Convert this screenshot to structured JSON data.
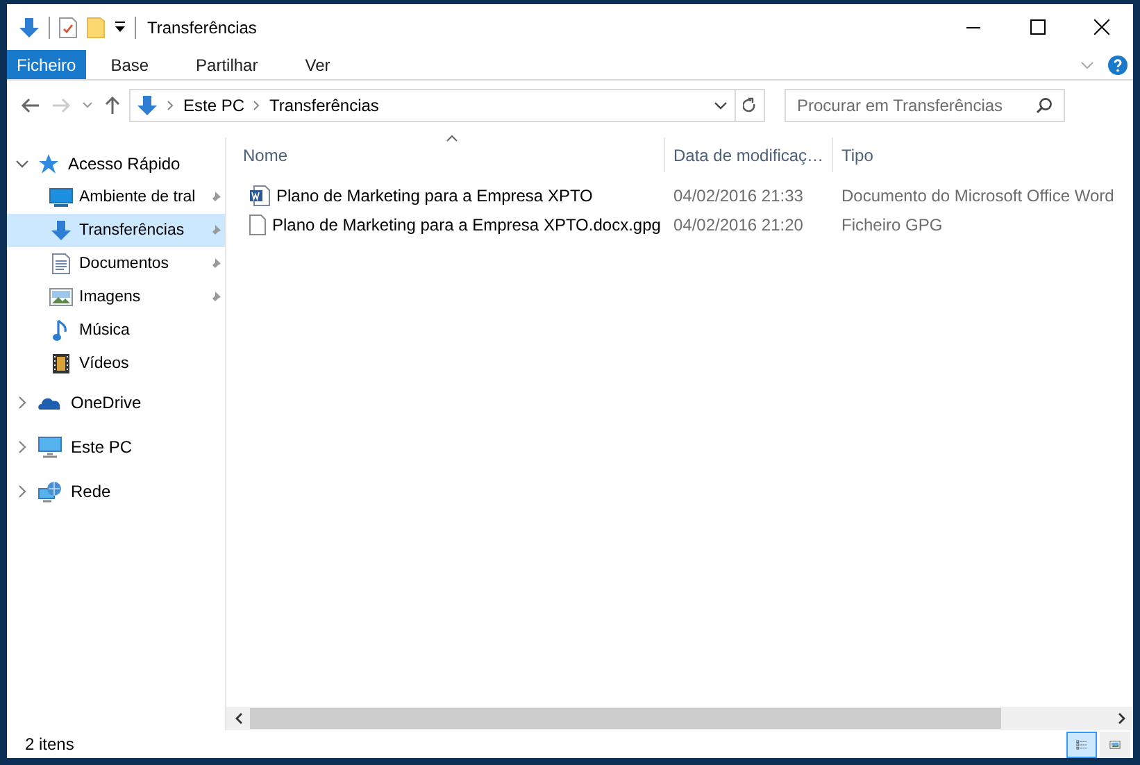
{
  "window": {
    "title": "Transferências"
  },
  "ribbon_tabs": [
    {
      "label": "Ficheiro",
      "kind": "file"
    },
    {
      "label": "Base",
      "kind": "tab"
    },
    {
      "label": "Partilhar",
      "kind": "tab"
    },
    {
      "label": "Ver",
      "kind": "tab"
    }
  ],
  "address": {
    "path": [
      "Este PC",
      "Transferências"
    ]
  },
  "search": {
    "placeholder": "Procurar em Transferências"
  },
  "sidebar": {
    "items": [
      {
        "label": "Acesso Rápido",
        "expanded": true,
        "children": [
          {
            "label": "Ambiente de tral",
            "pinned": true,
            "selected": false
          },
          {
            "label": "Transferências",
            "pinned": true,
            "selected": true
          },
          {
            "label": "Documentos",
            "pinned": true,
            "selected": false
          },
          {
            "label": "Imagens",
            "pinned": true,
            "selected": false
          },
          {
            "label": "Música",
            "pinned": false,
            "selected": false
          },
          {
            "label": "Vídeos",
            "pinned": false,
            "selected": false
          }
        ]
      },
      {
        "label": "OneDrive",
        "expanded": false
      },
      {
        "label": "Este PC",
        "expanded": false
      },
      {
        "label": "Rede",
        "expanded": false
      }
    ]
  },
  "table": {
    "columns": [
      {
        "label": "Nome",
        "sorted": true
      },
      {
        "label": "Data de modificaç…",
        "sorted": false
      },
      {
        "label": "Tipo",
        "sorted": false
      }
    ],
    "rows": [
      {
        "name": "Plano de Marketing para a Empresa XPTO",
        "date": "04/02/2016 21:33",
        "type": "Documento do Microsoft Office Word"
      },
      {
        "name": "Plano de Marketing para a Empresa XPTO.docx.gpg",
        "date": "04/02/2016 21:20",
        "type": "Ficheiro GPG"
      }
    ]
  },
  "status_bar": {
    "count": "2 itens",
    "views": [
      {
        "selected": true
      },
      {
        "selected": false
      }
    ]
  }
}
